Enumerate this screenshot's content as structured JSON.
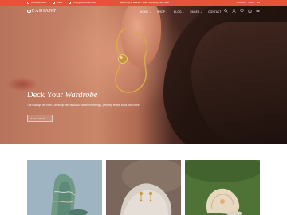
{
  "colors": {
    "accent": "#e8513a",
    "hero_dark": "#201210",
    "white": "#ffffff"
  },
  "topbar": {
    "phone": "(000) 000-000",
    "phone_icon": "phone-icon",
    "store": "Shop",
    "store_icon": "store-icon",
    "email": "info@yourdomain.com",
    "email_icon": "mail-icon",
    "promo_prefix": "Spend up to",
    "promo_highlight": "$99.00",
    "promo_suffix": "- Free Shipping Over Now",
    "right_items": [
      "Account",
      "USD",
      "EN"
    ]
  },
  "nav": {
    "logo": "CADIANT",
    "menu": [
      {
        "label": "HOME",
        "active": true,
        "has_dropdown": true
      },
      {
        "label": "SHOP",
        "active": false,
        "has_dropdown": true
      },
      {
        "label": "BLOG",
        "active": false,
        "has_dropdown": true
      },
      {
        "label": "PAGES",
        "active": false,
        "has_dropdown": true
      },
      {
        "label": "CONTACT",
        "active": false,
        "has_dropdown": false
      }
    ],
    "icons": [
      "search-icon",
      "user-icon",
      "heart-icon",
      "cart-icon",
      "menu-icon"
    ],
    "wishlist_count": "0",
    "cart_count": "0"
  },
  "hero": {
    "title_plain": "Deck Your ",
    "title_italic": "Wardrobe",
    "subtitle": "The holidays are here—dress up with fabulous statement earrings, perfectly festive looks, and more.",
    "button": "SHOP NOW →"
  },
  "products": [
    {
      "name": "Teal stone",
      "icon": "stone-image"
    },
    {
      "name": "Gold earrings on stone",
      "icon": "earring-image"
    },
    {
      "name": "Shell on green",
      "icon": "shell-image"
    }
  ]
}
